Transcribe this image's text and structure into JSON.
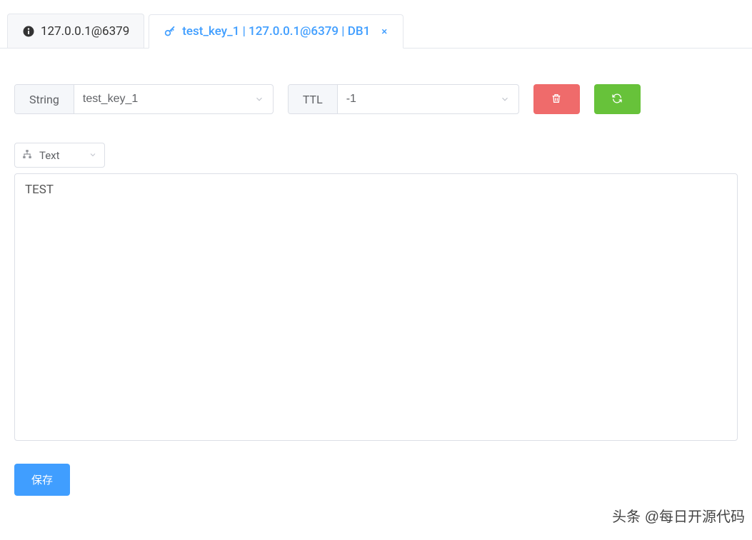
{
  "tabs": [
    {
      "label": "127.0.0.1@6379",
      "active": false,
      "closable": false
    },
    {
      "label": "test_key_1 | 127.0.0.1@6379 | DB1",
      "active": true,
      "closable": true
    }
  ],
  "key_type_label": "String",
  "key_name": "test_key_1",
  "ttl_label": "TTL",
  "ttl_value": "-1",
  "view_mode": "Text",
  "value": "TEST",
  "save_label": "保存",
  "watermark": "头条 @每日开源代码",
  "colors": {
    "primary": "#409eff",
    "danger": "#ef6b6b",
    "success": "#67c23a"
  }
}
